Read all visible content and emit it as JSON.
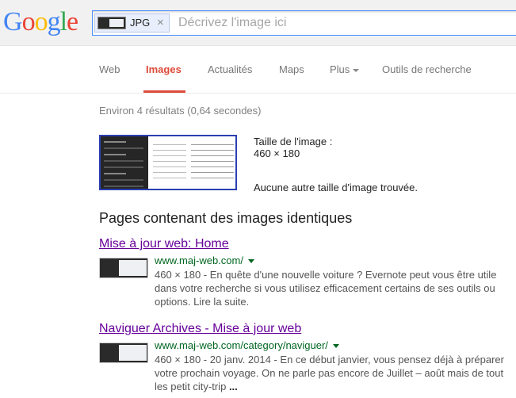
{
  "logo": {
    "letters": [
      "G",
      "o",
      "o",
      "g",
      "l",
      "e"
    ]
  },
  "search": {
    "chip_label": "JPG",
    "chip_close": "×",
    "placeholder": "Décrivez l'image ici",
    "value": ""
  },
  "tabs": [
    {
      "label": "Web",
      "active": false
    },
    {
      "label": "Images",
      "active": true
    },
    {
      "label": "Actualités",
      "active": false
    },
    {
      "label": "Maps",
      "active": false
    },
    {
      "label": "Plus",
      "active": false,
      "dropdown": true
    },
    {
      "label": "Outils de recherche",
      "active": false
    }
  ],
  "stats": "Environ 4 résultats (0,64 secondes)",
  "image_info": {
    "size_label": "Taille de l'image :",
    "size_value": "460 × 180",
    "no_other": "Aucune autre taille d'image trouvée."
  },
  "section_title": "Pages contenant des images identiques",
  "results": [
    {
      "title": "Mise à jour web: Home",
      "url": "www.maj-web.com/",
      "snippet_lines": [
        "460 × 180 - En quête d'une nouvelle voiture ? Evernote peut vous être utile",
        "dans votre recherche si vous utilisez efficacement certains de ses outils ou",
        "options. Lire la suite."
      ]
    },
    {
      "title": "Naviguer Archives - Mise à jour web",
      "url": "www.maj-web.com/category/naviguer/",
      "snippet_lines": [
        "460 × 180 - 20 janv. 2014 - En ce début janvier, vous pensez déjà à préparer",
        "votre prochain voyage. On ne parle pas encore de Juillet – août mais de tout",
        "les petit city-trip"
      ],
      "snippet_ellipsis": "..."
    }
  ],
  "colors": {
    "active_tab": "#dd4b39",
    "visited_link": "#660099",
    "url_green": "#006621",
    "snippet": "#545454"
  }
}
